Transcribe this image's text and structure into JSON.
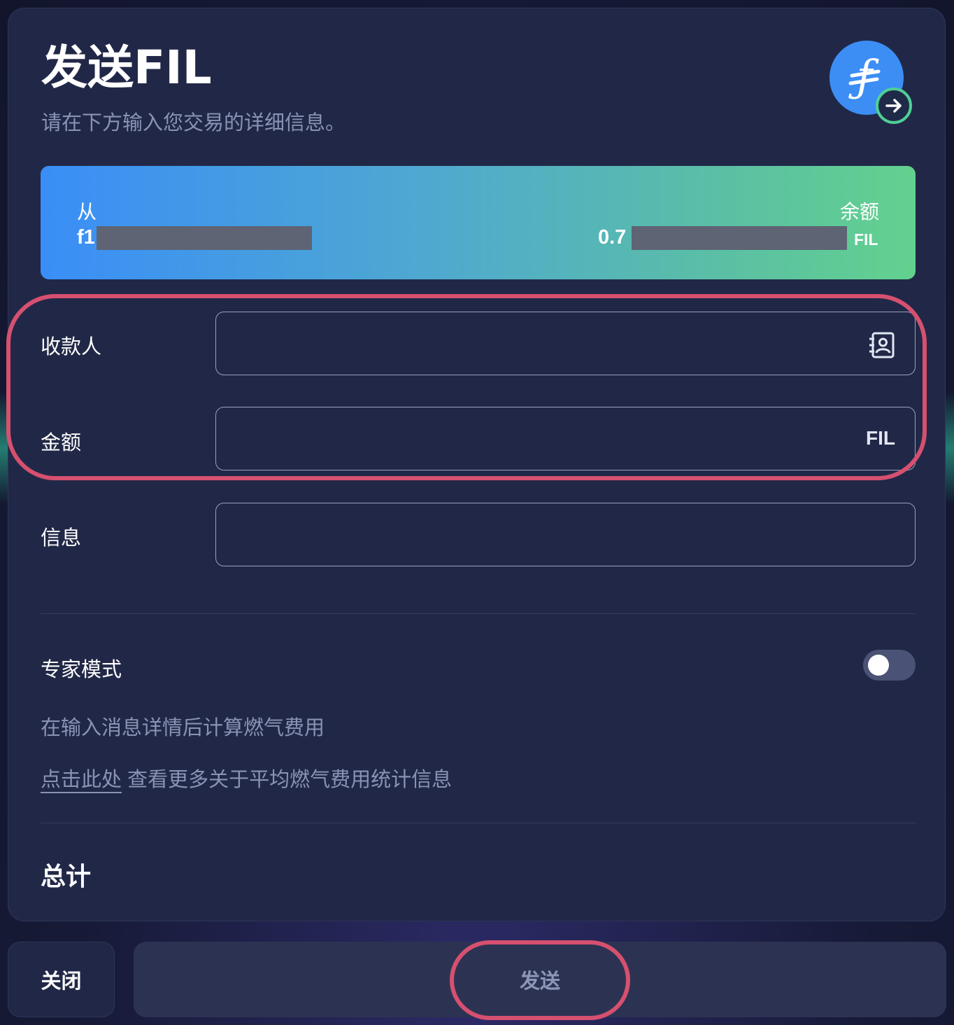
{
  "header": {
    "title_prefix": "发送",
    "title_token": "FIL",
    "subtitle": "请在下方输入您交易的详细信息。",
    "logo_glyph": "ƒ",
    "logo_icon": "filecoin-logo-icon",
    "badge_icon": "arrow-right-circle-icon"
  },
  "banner": {
    "from_label": "从",
    "from_address": "f1",
    "balance_label": "余额",
    "balance_value": "0.7",
    "balance_unit": "FIL"
  },
  "form": {
    "recipient_label": "收款人",
    "recipient_value": "",
    "recipient_icon": "address-book-icon",
    "amount_label": "金额",
    "amount_value": "",
    "amount_unit": "FIL",
    "message_label": "信息",
    "message_value": ""
  },
  "expert": {
    "label": "专家模式",
    "enabled": false,
    "gas_note": "在输入消息详情后计算燃气费用",
    "link_text": "点击此处",
    "link_rest": " 查看更多关于平均燃气费用统计信息"
  },
  "total": {
    "label": "总计"
  },
  "footer": {
    "close_label": "关闭",
    "send_label": "发送"
  },
  "colors": {
    "card_bg": "#212847",
    "highlight": "#d6506f",
    "banner_start": "#3a8ef7",
    "banner_end": "#63d18e",
    "logo_blue": "#3c8ef5",
    "badge_green": "#4fcf96"
  }
}
